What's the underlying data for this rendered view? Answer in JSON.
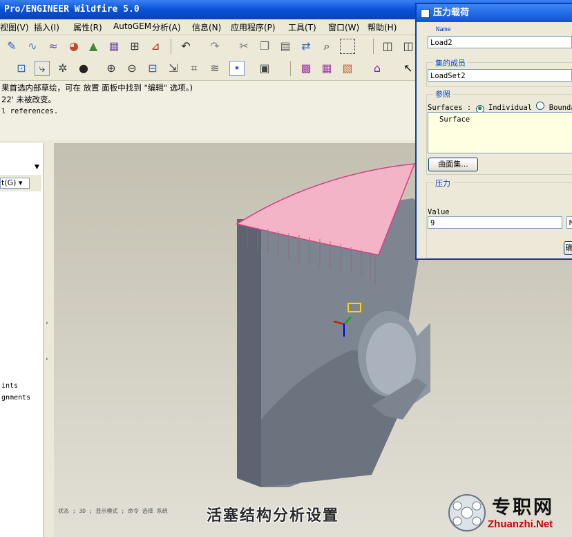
{
  "app": {
    "title": "Pro/ENGINEER Wildfire 5.0"
  },
  "menu": [
    "视图(V)",
    "插入(I)",
    "属性(R)",
    "AutoGEM",
    "分析(A)",
    "信息(N)",
    "应用程序(P)",
    "工具(T)",
    "窗口(W)",
    "帮助(H)"
  ],
  "messages": [
    "果首选内部草绘，可在 放置 面板中找到 \"编辑\" 选项。)",
    "22' 未被改变。",
    "l references."
  ],
  "left_panel": {
    "combo": "t(G)",
    "items": [
      "ints",
      "gnments"
    ]
  },
  "dialog": {
    "title": "压力载荷",
    "name_label": "Name",
    "name_value": "Load2",
    "member_label": "集的成员",
    "member_value": "LoadSet2",
    "ref_label": "参照",
    "surfaces_label": "Surfaces :",
    "option_individual": "Individual",
    "option_boundary": "Boundar",
    "surface_item": "Surface",
    "surface_set_button": "曲面集...",
    "pressure_label": "压力",
    "value_label": "Value",
    "value": "9",
    "unit": "M",
    "ok_button": "确"
  },
  "caption": "活塞结构分析设置",
  "status_small": "状态 ; 3D ; 显示模式 ; 命令 选择 系统",
  "logo": {
    "cn": "专职网",
    "url": "Zhuanzhi.Net"
  },
  "icons": [
    "sketch-icon",
    "curve-icon",
    "wave-icon",
    "color-icon",
    "datum-icon",
    "mesh-icon",
    "model-icon",
    "measure-icon",
    "undo-icon",
    "redo-icon",
    "cut-icon",
    "copy-icon",
    "paste-icon",
    "regenerate-icon",
    "find-icon",
    "select-box-icon",
    "view-icon"
  ]
}
